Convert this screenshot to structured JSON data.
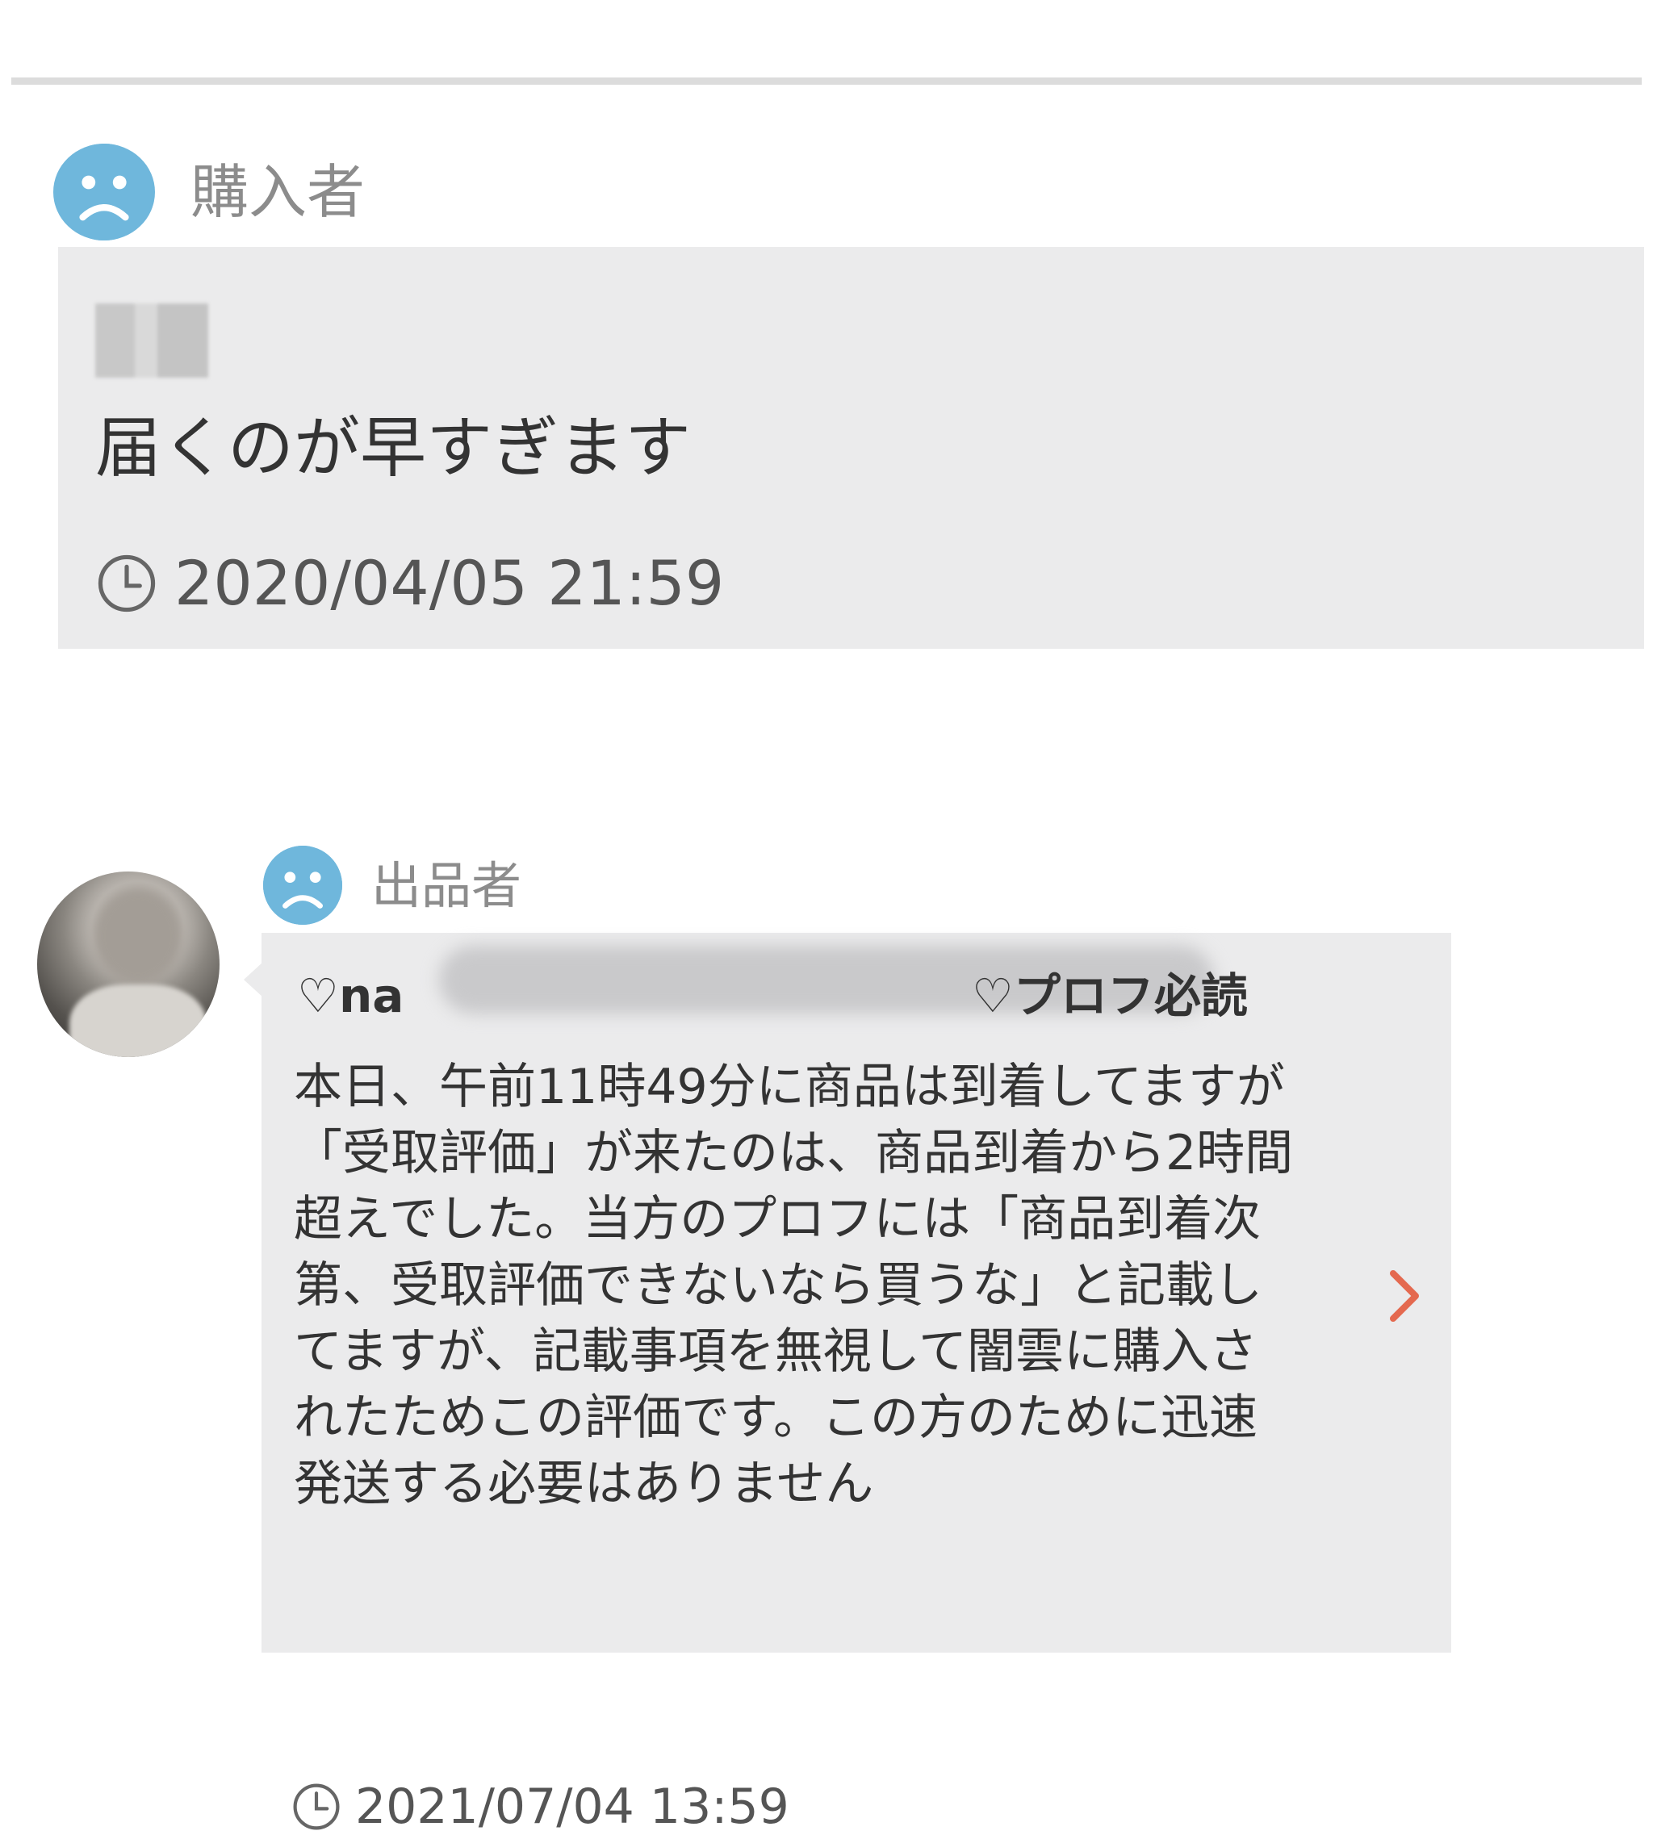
{
  "buyer_review": {
    "role_label": "購入者",
    "face_icon": "sad-face-icon",
    "comment": "届くのが早すぎます",
    "date": "2020/04/05 21:59"
  },
  "seller_reply": {
    "role_label": "出品者",
    "face_icon": "sad-face-icon",
    "name_visible": "♡na",
    "title_suffix": "♡プロフ必読",
    "body": "本日、午前11時49分に商品は到着してますが\n「受取評価」が来たのは、商品到着から2時間\n超えでした。当方のプロフには「商品到着次\n第、受取評価できないなら買うな」と記載し\nてますが、記載事項を無視して闇雲に購入さ\nれたためこの評価です。この方のために迅速\n発送する必要はありません",
    "date": "2021/07/04 13:59"
  },
  "colors": {
    "face_blue": "#6fb7dc",
    "card_bg": "#ebebec",
    "label_gray": "#8c8c8c",
    "chevron_red": "#e4694f"
  }
}
